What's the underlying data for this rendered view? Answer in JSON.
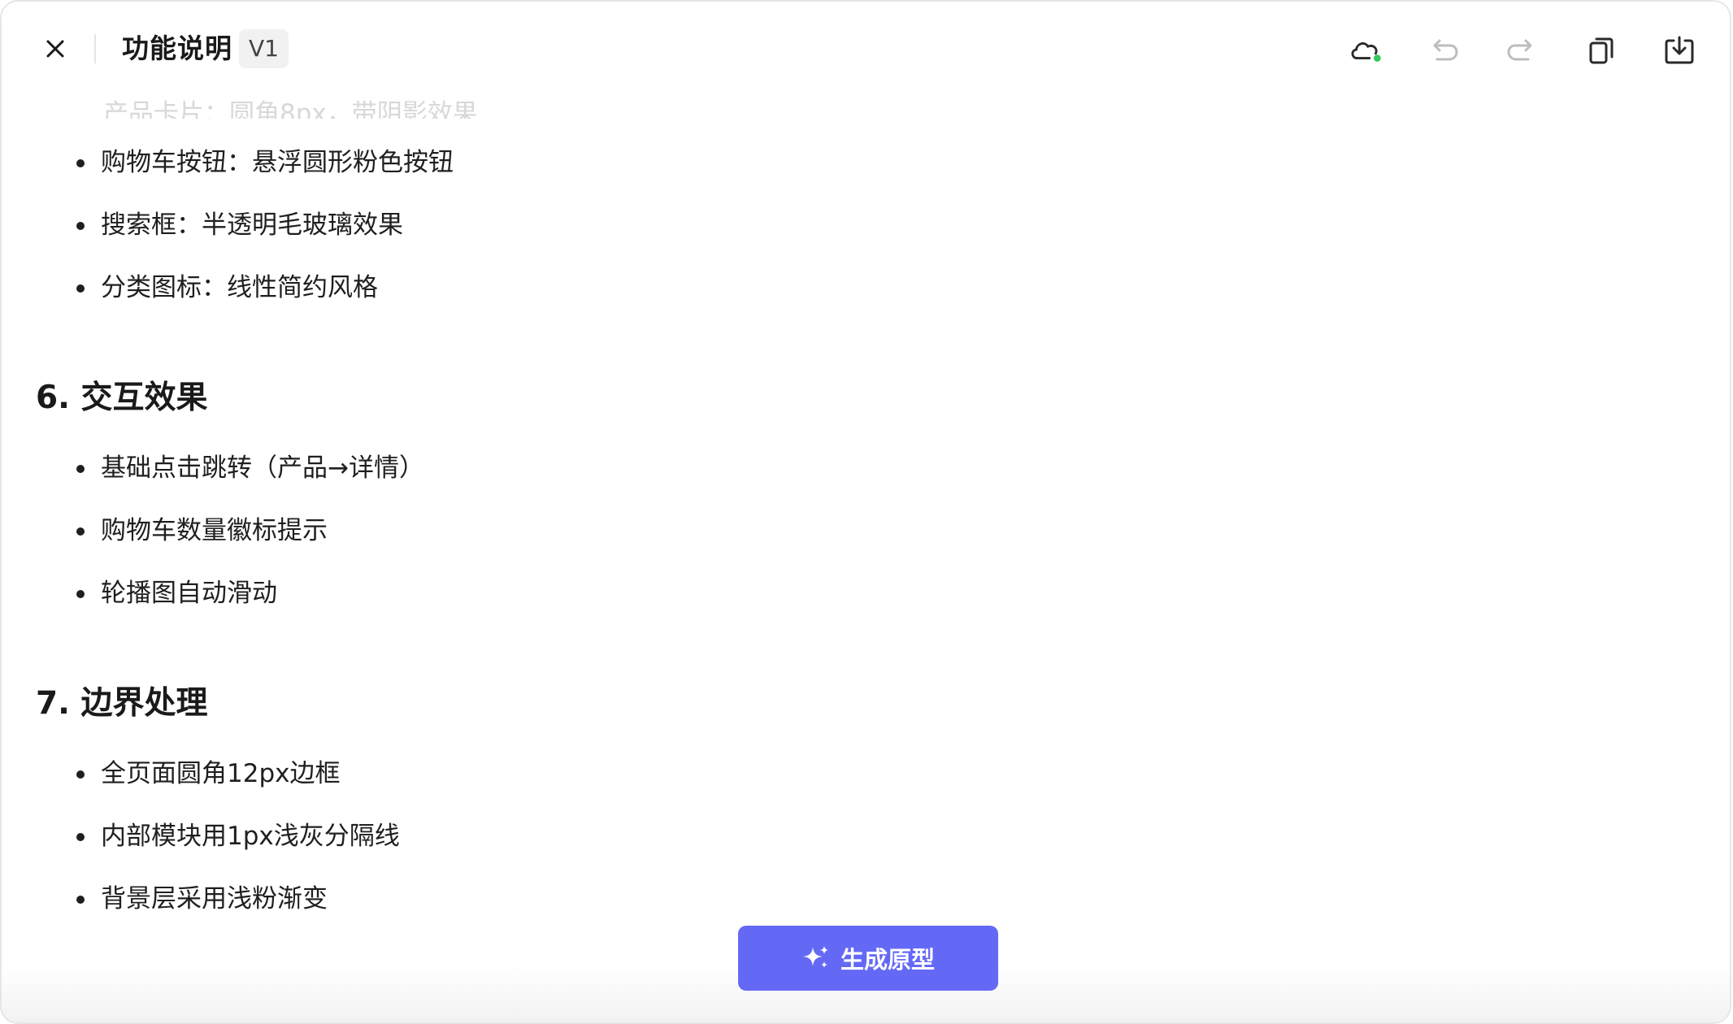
{
  "header": {
    "title": "功能说明",
    "version": "V1"
  },
  "faded_item": "产品卡片：圆角8px，带阴影效果",
  "section5": {
    "items": [
      "购物车按钮：悬浮圆形粉色按钮",
      "搜索框：半透明毛玻璃效果",
      "分类图标：线性简约风格"
    ]
  },
  "section6": {
    "heading": "6. 交互效果",
    "items": [
      "基础点击跳转（产品→详情）",
      "购物车数量徽标提示",
      "轮播图自动滑动"
    ]
  },
  "section7": {
    "heading": "7. 边界处理",
    "items": [
      "全页面圆角12px边框",
      "内部模块用1px浅灰分隔线",
      "背景层采用浅粉渐变"
    ]
  },
  "generate_button": {
    "label": "生成原型",
    "icon": "sparkle-icon"
  },
  "toolbar": {
    "icons": [
      "cloud-sync-icon",
      "undo-icon",
      "redo-icon",
      "copy-icon",
      "download-icon"
    ],
    "sync_status_color": "#34c759"
  },
  "colors": {
    "accent": "#6469f5"
  }
}
